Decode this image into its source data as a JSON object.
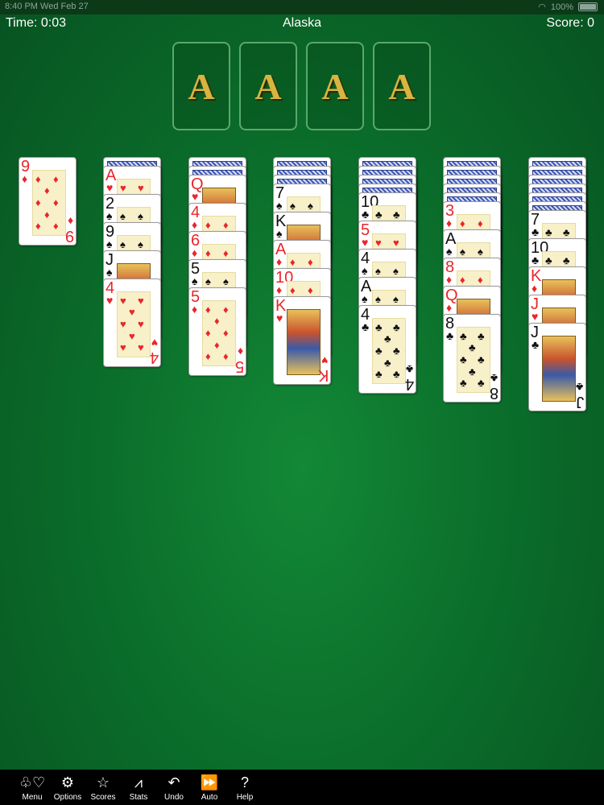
{
  "status_bar": {
    "time": "8:40 PM",
    "date": "Wed Feb 27",
    "battery": "100%"
  },
  "header": {
    "time": "Time: 0:03",
    "title": "Alaska",
    "score": "Score: 0"
  },
  "foundations": [
    {
      "label": "A"
    },
    {
      "label": "A"
    },
    {
      "label": "A"
    },
    {
      "label": "A"
    }
  ],
  "tableau": [
    {
      "backs": 0,
      "cards": [
        {
          "rank": "9",
          "suit": "diamonds",
          "color": "red",
          "face": false
        }
      ]
    },
    {
      "backs": 1,
      "cards": [
        {
          "rank": "A",
          "suit": "hearts",
          "color": "red",
          "face": false
        },
        {
          "rank": "2",
          "suit": "spades",
          "color": "black",
          "face": false
        },
        {
          "rank": "9",
          "suit": "spades",
          "color": "black",
          "face": false
        },
        {
          "rank": "J",
          "suit": "spades",
          "color": "black",
          "face": true
        },
        {
          "rank": "4",
          "suit": "hearts",
          "color": "red",
          "face": false
        }
      ]
    },
    {
      "backs": 2,
      "cards": [
        {
          "rank": "Q",
          "suit": "hearts",
          "color": "red",
          "face": true
        },
        {
          "rank": "4",
          "suit": "diamonds",
          "color": "red",
          "face": false
        },
        {
          "rank": "6",
          "suit": "diamonds",
          "color": "red",
          "face": false
        },
        {
          "rank": "5",
          "suit": "spades",
          "color": "black",
          "face": false
        },
        {
          "rank": "5",
          "suit": "diamonds",
          "color": "red",
          "face": false
        }
      ]
    },
    {
      "backs": 3,
      "cards": [
        {
          "rank": "7",
          "suit": "spades",
          "color": "black",
          "face": false
        },
        {
          "rank": "K",
          "suit": "spades",
          "color": "black",
          "face": true
        },
        {
          "rank": "A",
          "suit": "diamonds",
          "color": "red",
          "face": false
        },
        {
          "rank": "10",
          "suit": "diamonds",
          "color": "red",
          "face": false
        },
        {
          "rank": "K",
          "suit": "hearts",
          "color": "red",
          "face": true
        }
      ]
    },
    {
      "backs": 4,
      "cards": [
        {
          "rank": "10",
          "suit": "clubs",
          "color": "black",
          "face": false
        },
        {
          "rank": "5",
          "suit": "hearts",
          "color": "red",
          "face": false
        },
        {
          "rank": "4",
          "suit": "spades",
          "color": "black",
          "face": false
        },
        {
          "rank": "A",
          "suit": "spades",
          "color": "black",
          "face": false
        },
        {
          "rank": "4",
          "suit": "clubs",
          "color": "black",
          "face": false
        }
      ]
    },
    {
      "backs": 5,
      "cards": [
        {
          "rank": "3",
          "suit": "diamonds",
          "color": "red",
          "face": false
        },
        {
          "rank": "A",
          "suit": "spades",
          "color": "black",
          "face": false
        },
        {
          "rank": "8",
          "suit": "diamonds",
          "color": "red",
          "face": false
        },
        {
          "rank": "Q",
          "suit": "diamonds",
          "color": "red",
          "face": true
        },
        {
          "rank": "8",
          "suit": "clubs",
          "color": "black",
          "face": false
        }
      ]
    },
    {
      "backs": 6,
      "cards": [
        {
          "rank": "7",
          "suit": "clubs",
          "color": "black",
          "face": false
        },
        {
          "rank": "10",
          "suit": "clubs",
          "color": "black",
          "face": false
        },
        {
          "rank": "K",
          "suit": "diamonds",
          "color": "red",
          "face": true
        },
        {
          "rank": "J",
          "suit": "hearts",
          "color": "red",
          "face": true
        },
        {
          "rank": "J",
          "suit": "clubs",
          "color": "black",
          "face": true
        }
      ]
    }
  ],
  "toolbar": [
    {
      "label": "Menu",
      "icon": "menu-suits-icon",
      "glyph": "♧♡"
    },
    {
      "label": "Options",
      "icon": "gear-icon",
      "glyph": "⚙"
    },
    {
      "label": "Scores",
      "icon": "star-icon",
      "glyph": "☆"
    },
    {
      "label": "Stats",
      "icon": "chart-icon",
      "glyph": "⩘"
    },
    {
      "label": "Undo",
      "icon": "undo-icon",
      "glyph": "↶"
    },
    {
      "label": "Auto",
      "icon": "fast-forward-icon",
      "glyph": "⏩"
    },
    {
      "label": "Help",
      "icon": "question-icon",
      "glyph": "?"
    }
  ],
  "colors": {
    "felt": "#0b6f2b",
    "red_suit": "#e8262c",
    "black_suit": "#111111",
    "ace_gold": "#d9b441"
  }
}
